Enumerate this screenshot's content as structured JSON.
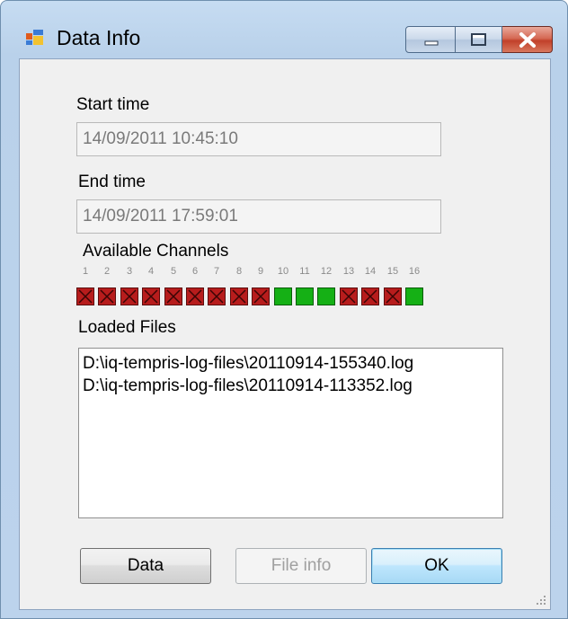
{
  "window": {
    "title": "Data Info"
  },
  "start": {
    "label": "Start time",
    "value": "14/09/2011 10:45:10"
  },
  "end": {
    "label": "End time",
    "value": "14/09/2011 17:59:01"
  },
  "channels": {
    "label": "Available Channels",
    "numbers": [
      "1",
      "2",
      "3",
      "4",
      "5",
      "6",
      "7",
      "8",
      "9",
      "10",
      "11",
      "12",
      "13",
      "14",
      "15",
      "16"
    ],
    "status": [
      "unavailable",
      "unavailable",
      "unavailable",
      "unavailable",
      "unavailable",
      "unavailable",
      "unavailable",
      "unavailable",
      "unavailable",
      "available",
      "available",
      "available",
      "unavailable",
      "unavailable",
      "unavailable",
      "available"
    ],
    "colors": {
      "available": "#15b015",
      "unavailable": "#b71c1c"
    }
  },
  "files": {
    "label": "Loaded Files",
    "items": [
      "D:\\iq-tempris-log-files\\20110914-155340.log",
      "D:\\iq-tempris-log-files\\20110914-113352.log"
    ]
  },
  "buttons": {
    "data": "Data",
    "file_info": "File info",
    "ok": "OK"
  }
}
